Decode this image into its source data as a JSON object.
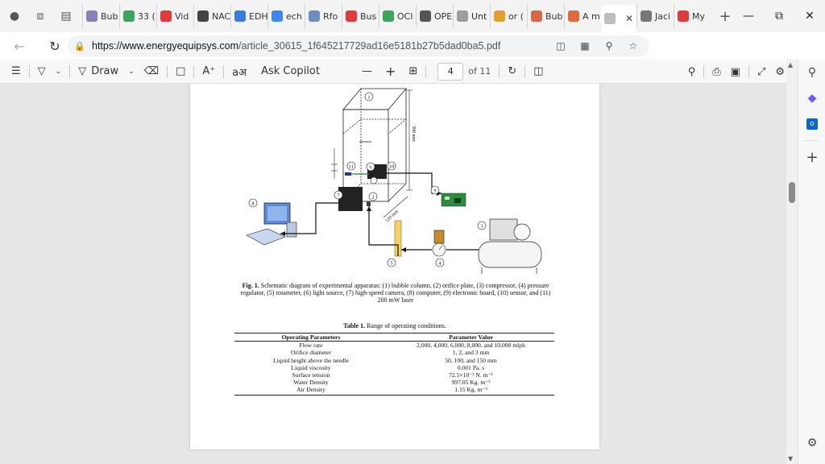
{
  "tabs": [
    {
      "label": "Bub",
      "color": "#8a7fb8"
    },
    {
      "label": "33 (",
      "color": "#3aa55b"
    },
    {
      "label": "Vid",
      "color": "#e03a3a"
    },
    {
      "label": "NAC",
      "color": "#444444"
    },
    {
      "label": "EDH",
      "color": "#3a7be0"
    },
    {
      "label": "ech",
      "color": "#4285f4"
    },
    {
      "label": "Rfo",
      "color": "#6c8ebf"
    },
    {
      "label": "Bus",
      "color": "#e03a3a"
    },
    {
      "label": "OCl",
      "color": "#3aa55b"
    },
    {
      "label": "OPE",
      "color": "#555555"
    },
    {
      "label": "Unt",
      "color": "#9e9e9e"
    },
    {
      "label": "or (",
      "color": "#e0a030"
    },
    {
      "label": "Bub",
      "color": "#d8674a"
    },
    {
      "label": "A m",
      "color": "#e06a3a"
    },
    {
      "label": "",
      "color": "#bdbdbd"
    },
    {
      "label": "Jaci",
      "color": "#777777"
    },
    {
      "label": "My",
      "color": "#e03a3a"
    }
  ],
  "address": {
    "host": "https://www.energyequipsys.com",
    "path": "/article_30615_1f645217729ad16e5181b27b5dad0ba5.pdf"
  },
  "toolbar": {
    "draw_label": "Draw",
    "copilot_label": "Ask Copilot",
    "current_page": "4",
    "page_total": "of 11"
  },
  "figure": {
    "labels": [
      "1",
      "2",
      "3",
      "4",
      "5",
      "6",
      "7",
      "8",
      "9",
      "10",
      "11"
    ],
    "dim_height": "300 mm",
    "dim_width": "120 mm",
    "caption_prefix": "Fig. 1.",
    "caption_text": " Schematic diagram of experimental apparatus: (1) bubble column, (2) orifice plate, (3) compressor, (4) pressure regulator, (5) rotameter, (6) light source, (7) high-speed camera, (8) computer, (9) electronic board, (10) sensor, and (11) 200 mW laser"
  },
  "table": {
    "title_prefix": "Table 1.",
    "title_text": " Range of operating conditions.",
    "headers": [
      "Operating Parameters",
      "Parameter Value"
    ],
    "rows": [
      [
        "Flow rate",
        "2,000, 4,000, 6,000, 8,000, and 10,000 mlph"
      ],
      [
        "Orifice diameter",
        "1, 2, and 3 mm"
      ],
      [
        "Liquid height above the needle",
        "50, 100, and 150 mm"
      ],
      [
        "Liquid viscosity",
        "0.001 Pa. s"
      ],
      [
        "Surface tension",
        "72.5×10⁻³ N. m⁻¹"
      ],
      [
        "Water Density",
        "997.05 Kg. m⁻³"
      ],
      [
        "Air Density",
        "1.15 Kg. m⁻³"
      ]
    ]
  },
  "icons": [
    "profile-icon",
    "workspaces-icon",
    "tab-actions-icon",
    "close-icon",
    "new-tab-icon",
    "minimize-icon",
    "restore-icon",
    "back-icon",
    "refresh-icon",
    "lock-icon",
    "read-aloud-icon",
    "zoom-icon",
    "favorite-icon",
    "split-screen-icon",
    "favorites-icon",
    "collections-icon",
    "performance-icon",
    "more-icon",
    "copilot-icon",
    "contents-icon",
    "highlight-icon",
    "draw-icon",
    "eraser-icon",
    "text-icon",
    "read-aloud-icon",
    "translate-icon",
    "fit-page-icon",
    "rotate-icon",
    "page-view-icon",
    "search-icon",
    "print-icon",
    "save-icon",
    "fullscreen-icon",
    "settings-icon"
  ]
}
